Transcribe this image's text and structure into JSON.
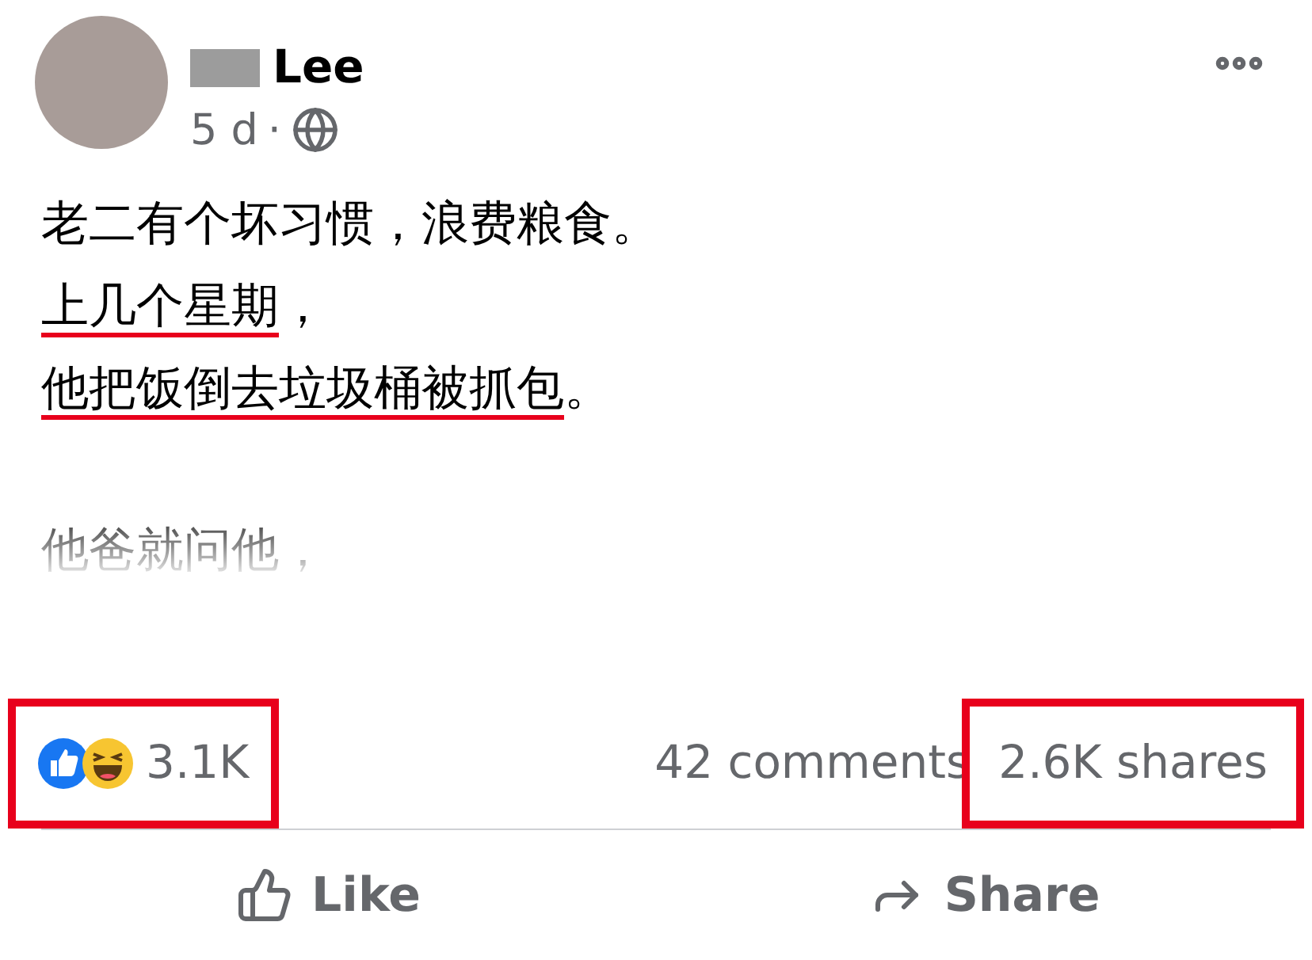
{
  "author": {
    "name": "Lee",
    "time": "5 d",
    "separator": "·"
  },
  "post": {
    "lines": [
      {
        "faded": false,
        "segments": [
          {
            "text": "老二有个坏习惯，浪费粮食。",
            "underlined": false
          }
        ]
      },
      {
        "faded": false,
        "segments": [
          {
            "text": "上几个星期",
            "underlined": true
          },
          {
            "text": "，",
            "underlined": false
          }
        ]
      },
      {
        "faded": false,
        "segments": [
          {
            "text": "他把饭倒去垃圾桶被抓包",
            "underlined": true
          },
          {
            "text": "。",
            "underlined": false
          }
        ]
      },
      {
        "faded": true,
        "segments": [
          {
            "text": "他爸就问他，",
            "underlined": false
          }
        ]
      }
    ]
  },
  "stats": {
    "reactions": {
      "count": "3.1K",
      "highlighted": true
    },
    "comments": {
      "text": "42 comments",
      "highlighted": false
    },
    "shares": {
      "text": "2.6K shares",
      "highlighted": true
    }
  },
  "actions": [
    {
      "kind": "like",
      "label": "Like"
    },
    {
      "kind": "share",
      "label": "Share"
    }
  ]
}
